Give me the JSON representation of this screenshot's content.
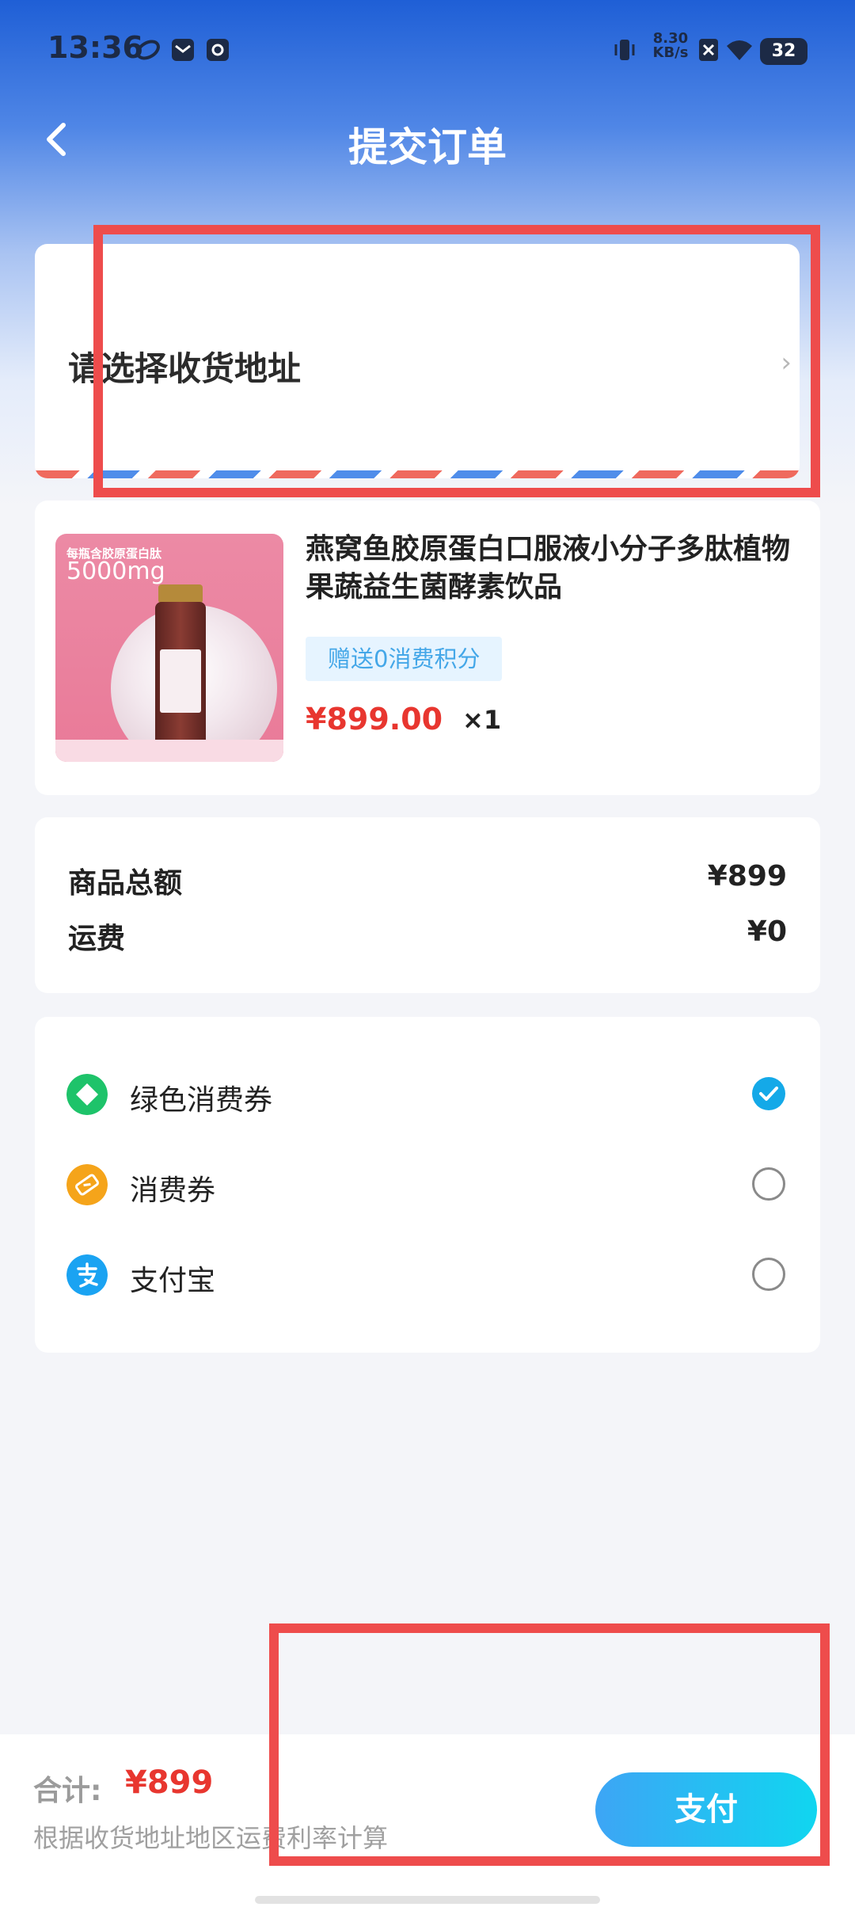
{
  "status_bar": {
    "time": "13:36",
    "net_speed_value": "8.30",
    "net_speed_unit": "KB/s",
    "battery": "32"
  },
  "header": {
    "title": "提交订单"
  },
  "address": {
    "prompt": "请选择收货地址"
  },
  "product": {
    "image_text_main": "每瓶含胶原蛋白肽",
    "image_text_amount": "5000mg",
    "title": "燕窝鱼胶原蛋白口服液小分子多肽植物果蔬益生菌酵素饮品",
    "points_tag": "赠送0消费积分",
    "price": "¥899.00",
    "quantity": "×1"
  },
  "summary": {
    "subtotal_label": "商品总额",
    "subtotal_value": "¥899",
    "shipping_label": "运费",
    "shipping_value": "¥0"
  },
  "payment_methods": [
    {
      "label": "绿色消费券",
      "icon": "green-voucher-icon",
      "selected": true,
      "color": "#1ec36a"
    },
    {
      "label": "消费券",
      "icon": "voucher-ticket-icon",
      "selected": false,
      "color": "#f5a41a"
    },
    {
      "label": "支付宝",
      "icon": "alipay-icon",
      "selected": false,
      "color": "#1aa3f2"
    }
  ],
  "footer": {
    "total_label": "合计:",
    "total_value": "¥899",
    "note": "根据收货地址地区运费利率计算",
    "pay_button": "支付"
  },
  "colors": {
    "accent_red": "#e8362f",
    "annotation_frame": "#ee4c4c",
    "pay_button_start": "#3da5f5",
    "pay_button_end": "#10d6f0"
  }
}
